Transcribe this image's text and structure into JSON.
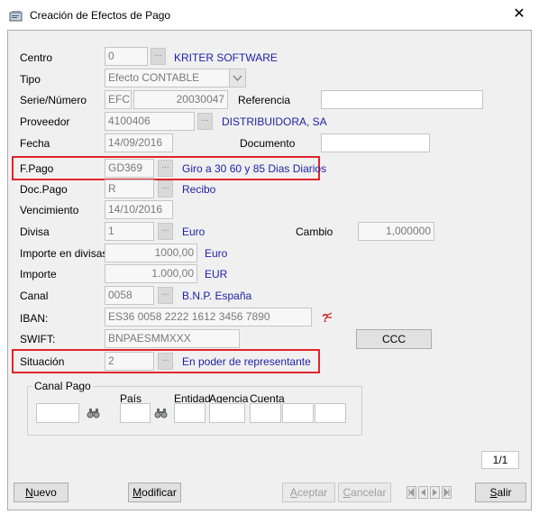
{
  "window": {
    "title": "Creación de Efectos de Pago"
  },
  "form": {
    "centro": {
      "label": "Centro",
      "value": "0",
      "desc": "KRITER SOFTWARE"
    },
    "tipo": {
      "label": "Tipo",
      "value": "Efecto CONTABLE"
    },
    "serie": {
      "label": "Serie/Número",
      "serie": "EFC",
      "numero": "20030047"
    },
    "referencia": {
      "label": "Referencia",
      "value": ""
    },
    "proveedor": {
      "label": "Proveedor",
      "value": "4100406",
      "desc": "DISTRIBUIDORA, SA"
    },
    "fecha": {
      "label": "Fecha",
      "value": "14/09/2016"
    },
    "documento": {
      "label": "Documento",
      "value": ""
    },
    "fpago": {
      "label": "F.Pago",
      "value": "GD369",
      "desc": "Giro a 30 60 y 85 Dias Diarios"
    },
    "docpago": {
      "label": "Doc.Pago",
      "value": "R",
      "desc": "Recibo"
    },
    "vencimiento": {
      "label": "Vencimiento",
      "value": "14/10/2016"
    },
    "divisa": {
      "label": "Divisa",
      "value": "1",
      "desc": "Euro"
    },
    "cambio": {
      "label": "Cambio",
      "value": "1,000000"
    },
    "importe_divisas": {
      "label": "Importe en divisas",
      "value": "1000,00",
      "desc": "Euro"
    },
    "importe": {
      "label": "Importe",
      "value": "1.000,00",
      "desc": "EUR"
    },
    "canal": {
      "label": "Canal",
      "value": "0058",
      "desc": "B.N.P. España"
    },
    "iban": {
      "label": "IBAN:",
      "value": "ES36 0058 2222 1612 3456 7890"
    },
    "swift": {
      "label": "SWIFT:",
      "value": "BNPAESMMXXX"
    },
    "ccc_button": "CCC",
    "situacion": {
      "label": "Situación",
      "value": "2",
      "desc": "En poder de representante"
    },
    "canal_pago": {
      "title": "Canal Pago",
      "pais_label": "País",
      "entidad_label": "Entidad",
      "agencia_label": "Agencia",
      "cuenta_label": "Cuenta"
    },
    "pager": "1/1"
  },
  "buttons": {
    "nuevo": "Nuevo",
    "modificar": "Modificar",
    "aceptar": "Aceptar",
    "cancelar": "Cancelar",
    "salir": "Salir"
  },
  "icons": {
    "window": "window-icon",
    "close": "close-icon",
    "binoculars": "binoculars-icon",
    "iban_help": "question-icon"
  },
  "colors": {
    "highlight": "#e1242c",
    "desc_text": "#1f1fa8"
  }
}
